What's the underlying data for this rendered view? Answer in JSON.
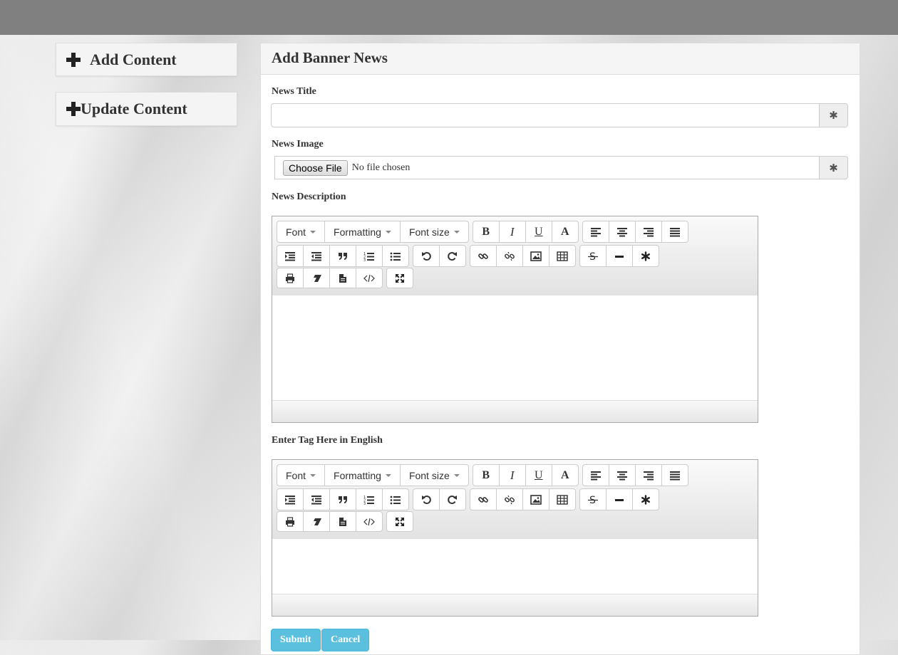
{
  "sidebar": {
    "items": [
      {
        "label": "Add Content",
        "icon": "plus-icon"
      },
      {
        "label": "Update Content",
        "icon": "plus-icon"
      }
    ]
  },
  "panel": {
    "title": "Add Banner News"
  },
  "form": {
    "title_label": "News Title",
    "title_value": "",
    "required_glyph": "✱",
    "image_label": "News Image",
    "file_button": "Choose File",
    "file_status": "No file chosen",
    "description_label": "News Description",
    "tag_label": "Enter Tag Here in English",
    "submit": "Submit",
    "cancel": "Cancel"
  },
  "editor_toolbar": {
    "font": "Font",
    "formatting": "Formatting",
    "font_size": "Font size",
    "bold": "B",
    "italic": "I",
    "underline": "U",
    "color": "A"
  },
  "colors": {
    "topbar": "#808080",
    "button_info": "#5bc0de"
  }
}
